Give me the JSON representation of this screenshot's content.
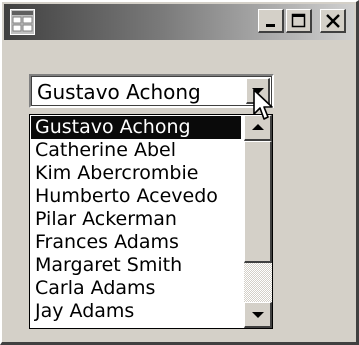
{
  "window": {
    "title": "",
    "icon": "form-icon",
    "buttons": {
      "minimize": "minimize-icon",
      "maximize": "maximize-icon",
      "close": "close-icon"
    }
  },
  "combo": {
    "value": "Gustavo Achong",
    "arrow_icon": "chevron-down-icon"
  },
  "dropdown": {
    "items": [
      {
        "label": "Gustavo Achong",
        "selected": true
      },
      {
        "label": "Catherine Abel",
        "selected": false
      },
      {
        "label": "Kim Abercrombie",
        "selected": false
      },
      {
        "label": "Humberto Acevedo",
        "selected": false
      },
      {
        "label": "Pilar Ackerman",
        "selected": false
      },
      {
        "label": "Frances Adams",
        "selected": false
      },
      {
        "label": "Margaret Smith",
        "selected": false
      },
      {
        "label": "Carla Adams",
        "selected": false
      },
      {
        "label": "Jay Adams",
        "selected": false
      }
    ],
    "scrollbar": {
      "up_icon": "arrow-up-icon",
      "down_icon": "arrow-down-icon"
    }
  },
  "colors": {
    "face": "#d4d0c8",
    "highlight": "#ffffff",
    "shadow": "#404040",
    "selection": "#0a0a0a"
  }
}
